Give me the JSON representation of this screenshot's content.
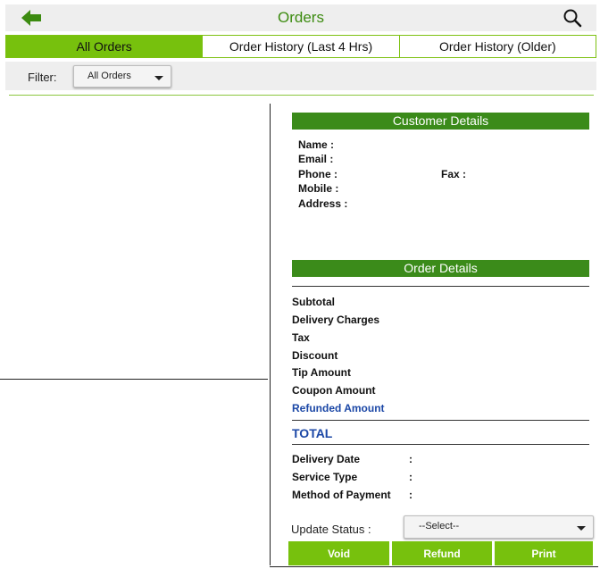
{
  "header": {
    "title": "Orders",
    "back_icon": "arrow-left-icon",
    "search_icon": "search-icon",
    "accent": "#3c8b10"
  },
  "tabs": [
    {
      "label": "All Orders",
      "active": true
    },
    {
      "label": "Order History (Last 4 Hrs)",
      "active": false
    },
    {
      "label": "Order History (Older)",
      "active": false
    }
  ],
  "filter": {
    "label": "Filter:",
    "selected": "All Orders"
  },
  "customer_details": {
    "title": "Customer Details",
    "name_label": "Name :",
    "email_label": "Email :",
    "phone_label": "Phone :",
    "fax_label": "Fax :",
    "mobile_label": "Mobile :",
    "address_label": "Address :"
  },
  "order_details": {
    "title": "Order Details",
    "rows": [
      "Subtotal",
      "Delivery Charges",
      "Tax",
      "Discount",
      "Tip Amount",
      "Coupon Amount"
    ],
    "refunded_label": "Refunded Amount",
    "total_label": "TOTAL"
  },
  "order_info": {
    "delivery_date_label": "Delivery Date",
    "service_type_label": "Service Type",
    "payment_method_label": "Method of Payment",
    "colon": ":"
  },
  "status": {
    "label": "Update Status :",
    "selected": "--Select--"
  },
  "actions": {
    "void_label": "Void",
    "refund_label": "Refund",
    "print_label": "Print"
  },
  "colors": {
    "tab_active": "#77c10d",
    "section_header": "#3b8b1a",
    "refunded": "#1b47a6"
  }
}
